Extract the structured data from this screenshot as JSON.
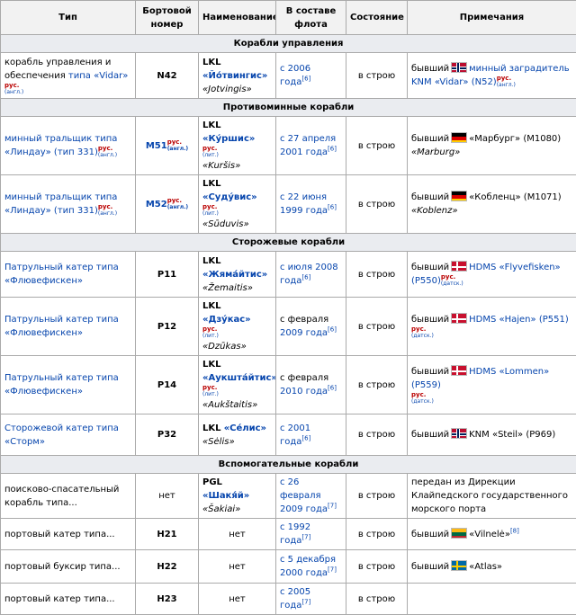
{
  "headers": [
    "Тип",
    "Бортовой номер",
    "Наименование",
    "В составе флота",
    "Состояние",
    "Примечания"
  ],
  "sections": {
    "control": "Корабли управления",
    "mine": "Противоминные корабли",
    "patrol": "Сторожевые корабли",
    "aux": "Вспомогательные корабли"
  },
  "langs": {
    "rus": "рус.",
    "engl": "(англ.)",
    "lit": "(лит.)",
    "dan": "(датск.)"
  },
  "refs": {
    "r6": "[6]",
    "r7": "[7]",
    "r8": "[8]"
  },
  "rows": [
    {
      "type_a": "корабль управления и обеспечения ",
      "type_link": "типа «Vidar»",
      "number": "N42",
      "name_prefix": "LKL",
      "name": "«Йо́твингис»",
      "name_orig": "«Jotvingis»",
      "since": "с 2006 года",
      "status": "в строю",
      "note_a": "бывший",
      "note_link": "минный заградитель KNM «Vidar» (N52)",
      "flag": "norway-flag"
    },
    {
      "type_link": "минный тральщик типа «Линдау» (тип 331)",
      "number": "M51",
      "name_prefix": "LKL",
      "name": "«Ку́ршис»",
      "name_orig": "«Kuršis»",
      "since": "с 27 апреля 2001 года",
      "status": "в строю",
      "note_a": "бывший",
      "note_b": "«Марбург» (M1080)",
      "note_orig": "«Marburg»",
      "flag": "germany-flag"
    },
    {
      "type_link": "минный тральщик типа «Линдау» (тип 331)",
      "number": "M52",
      "name_prefix": "LKL",
      "name": "«Суду́вис»",
      "name_orig": "«Sūduvis»",
      "since": "с 22 июня 1999 года",
      "status": "в строю",
      "note_a": "бывший",
      "note_b": "«Кобленц» (M1071)",
      "note_orig": "«Koblenz»",
      "flag": "germany-flag"
    },
    {
      "type_link": "Патрульный катер типа «Флювефискен»",
      "number": "P11",
      "name_prefix": "LKL",
      "name": "«Жяма́йтис»",
      "name_orig": "«Žemaitis»",
      "since": "с июля 2008 года",
      "status": "в строю",
      "note_a": "бывший",
      "note_link": "HDMS «Flyvefisken» (P550)",
      "flag": "denmark-flag"
    },
    {
      "type_link": "Патрульный катер типа «Флювефискен»",
      "number": "P12",
      "name_prefix": "LKL",
      "name": "«Дзу́кас»",
      "name_orig": "«Dzūkas»",
      "since_a": "с февраля",
      "since_link": "2009 года",
      "status": "в строю",
      "note_a": "бывший",
      "note_link": "HDMS «Hajen» (P551)",
      "flag": "denmark-flag"
    },
    {
      "type_link": "Патрульный катер типа «Флювефискен»",
      "number": "P14",
      "name_prefix": "LKL",
      "name": "«Аукшта́йтис»",
      "name_orig": "«Aukštaitis»",
      "since_a": "с февраля",
      "since_link": "2010 года",
      "status": "в строю",
      "note_a": "бывший",
      "note_link": "HDMS «Lommen» (P559)",
      "flag": "denmark-flag"
    },
    {
      "type_link": "Сторожевой катер типа «Сторм»",
      "number": "P32",
      "name_prefix": "LKL",
      "name": "«Се́лис»",
      "name_orig": "«Sėlis»",
      "since": "с 2001 года",
      "status": "в строю",
      "note_a": "бывший",
      "note_b": "KNM «Steil» (P969)",
      "flag": "norway-flag"
    },
    {
      "type_a": "поисково-спасательный корабль типа...",
      "number": "нет",
      "name_prefix": "PGL",
      "name": "«Шакя́й»",
      "name_orig": "«Šakiai»",
      "since": "с 26 февраля 2009 года",
      "status": "в строю",
      "note_b": "передан из Дирекции Клайпедского государственного морского порта"
    },
    {
      "type_a": "портовый катер типа...",
      "number": "H21",
      "name_plain": "нет",
      "since": "с 1992 года",
      "status": "в строю",
      "note_a": "бывший",
      "note_b": "«Vilnelė»",
      "flag": "lithuania-flag"
    },
    {
      "type_a": "портовый буксир типа...",
      "number": "H22",
      "name_plain": "нет",
      "since": "с 5 декабря 2000 года",
      "status": "в строю",
      "note_a": "бывший",
      "note_b": "«Atlas»",
      "flag": "sweden-flag"
    },
    {
      "type_a": "портовый катер типа...",
      "number": "H23",
      "name_plain": "нет",
      "since": "с 2005 года",
      "status": "в строю"
    }
  ]
}
